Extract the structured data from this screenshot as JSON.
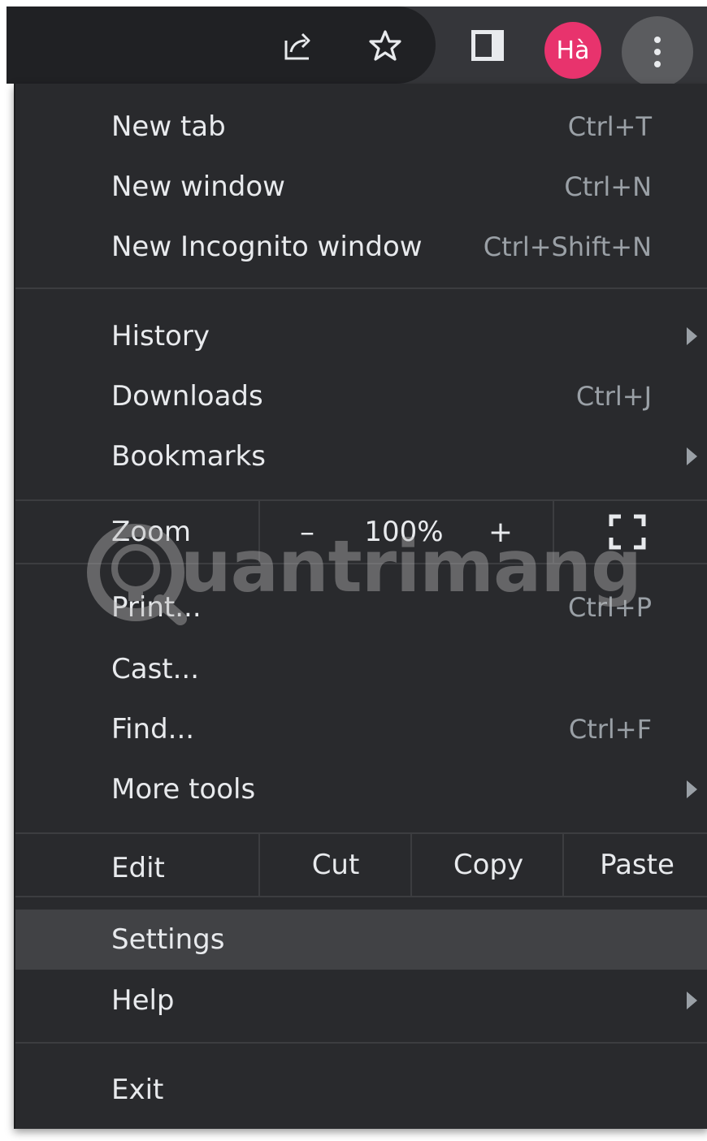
{
  "toolbar": {
    "share_icon": "share-icon",
    "bookmark_icon": "star-icon",
    "side_panel_icon": "side-panel-icon",
    "profile_initials": "Hà",
    "profile_color": "#e8336d",
    "menu_icon": "three-dots-vertical-icon"
  },
  "menu": {
    "new_tab": {
      "label": "New tab",
      "shortcut": "Ctrl+T"
    },
    "new_window": {
      "label": "New window",
      "shortcut": "Ctrl+N"
    },
    "new_incognito": {
      "label": "New Incognito window",
      "shortcut": "Ctrl+Shift+N"
    },
    "history": {
      "label": "History"
    },
    "downloads": {
      "label": "Downloads",
      "shortcut": "Ctrl+J"
    },
    "bookmarks": {
      "label": "Bookmarks"
    },
    "zoom": {
      "label": "Zoom",
      "minus": "–",
      "value": "100%",
      "plus": "+"
    },
    "print": {
      "label": "Print...",
      "shortcut": "Ctrl+P"
    },
    "cast": {
      "label": "Cast..."
    },
    "find": {
      "label": "Find...",
      "shortcut": "Ctrl+F"
    },
    "more_tools": {
      "label": "More tools"
    },
    "edit": {
      "label": "Edit",
      "cut": "Cut",
      "copy": "Copy",
      "paste": "Paste"
    },
    "settings": {
      "label": "Settings"
    },
    "help": {
      "label": "Help"
    },
    "exit": {
      "label": "Exit"
    }
  },
  "watermark": {
    "text": "uantrimang"
  },
  "colors": {
    "menu_bg": "#292a2d",
    "toolbar_bg": "#35363a",
    "highlight_bg": "#414245",
    "text": "#e8eaed",
    "shortcut_text": "#9aa0a6"
  }
}
